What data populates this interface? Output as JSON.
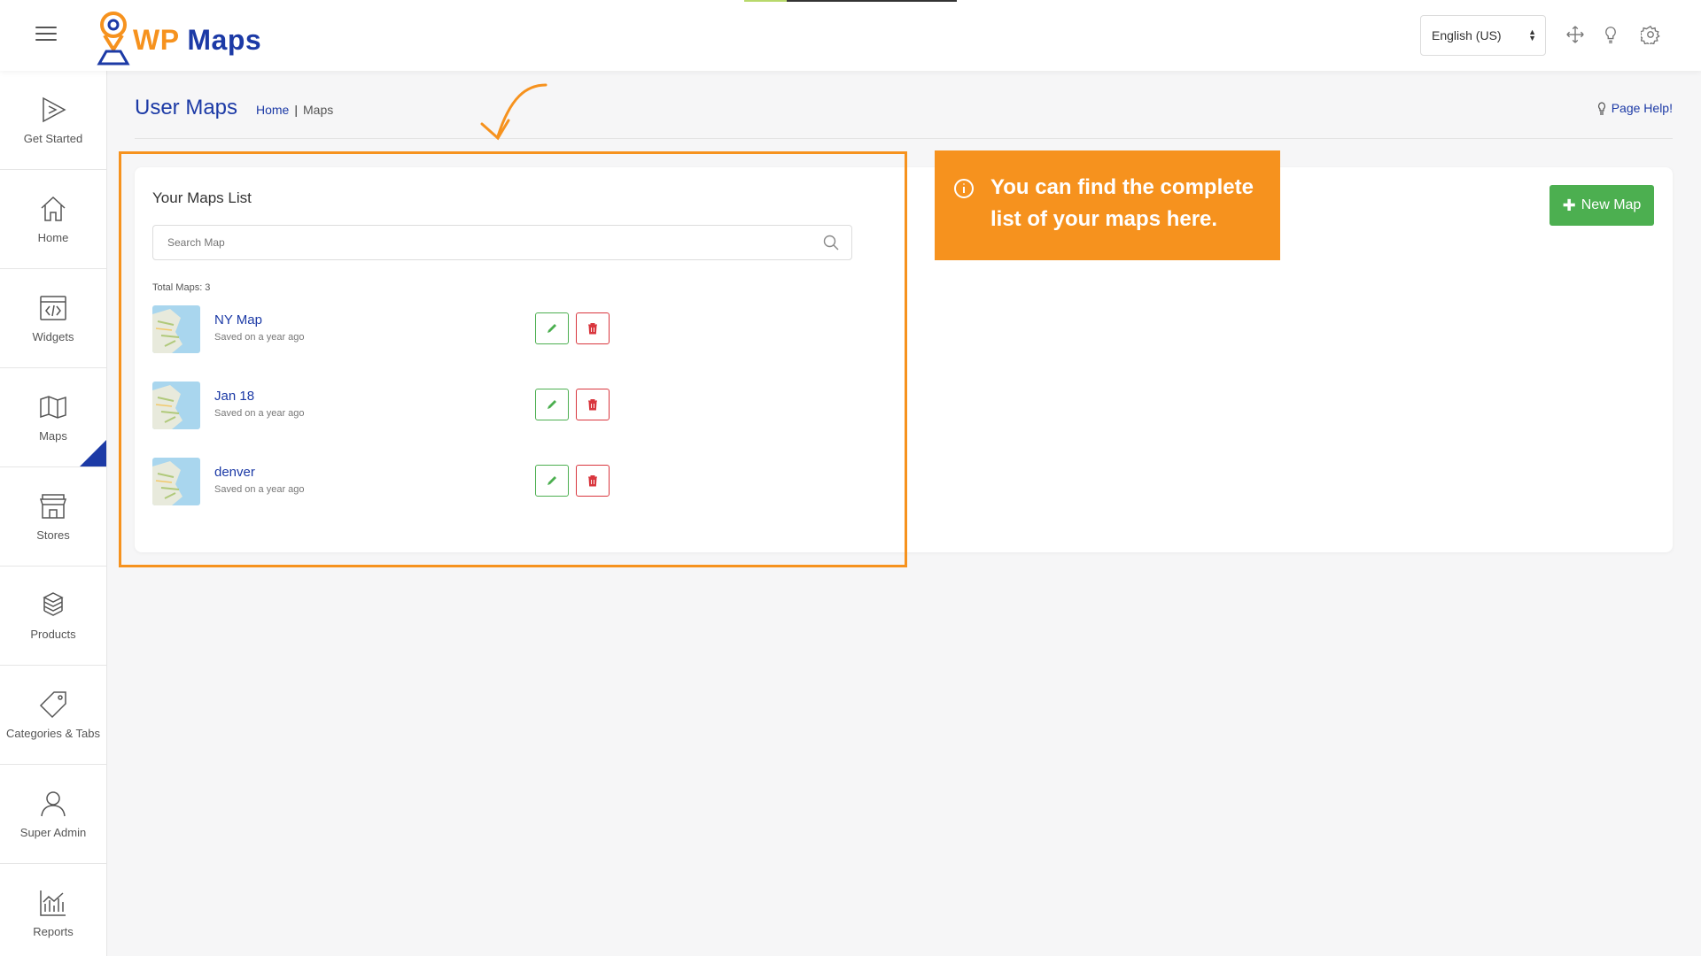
{
  "app": {
    "logo_prefix": "WP",
    "logo_suffix": " Maps",
    "language": "English (US)"
  },
  "sidebar": {
    "items": [
      {
        "label": "Get Started",
        "icon": "play-icon"
      },
      {
        "label": "Home",
        "icon": "home-icon"
      },
      {
        "label": "Widgets",
        "icon": "code-icon"
      },
      {
        "label": "Maps",
        "icon": "map-icon",
        "active": true
      },
      {
        "label": "Stores",
        "icon": "store-icon"
      },
      {
        "label": "Products",
        "icon": "boxes-icon"
      },
      {
        "label": "Categories & Tabs",
        "icon": "tag-icon"
      },
      {
        "label": "Super Admin",
        "icon": "user-icon"
      },
      {
        "label": "Reports",
        "icon": "chart-icon"
      }
    ]
  },
  "header": {
    "title": "User Maps",
    "breadcrumb": {
      "home": "Home",
      "separator": "|",
      "current": "Maps"
    },
    "page_help": "Page Help!"
  },
  "card": {
    "title": "Your Maps List",
    "search_placeholder": "Search Map",
    "total_label": "Total Maps: 3",
    "new_map_label": "New Map",
    "maps": [
      {
        "name": "NY Map",
        "saved": "Saved on a year ago"
      },
      {
        "name": "Jan 18",
        "saved": "Saved on a year ago"
      },
      {
        "name": "denver",
        "saved": "Saved on a year ago"
      }
    ]
  },
  "tutorial": {
    "tip_text": "You can find the complete list of your maps here."
  },
  "colors": {
    "brand_blue": "#1c3aa6",
    "brand_orange": "#f6921e",
    "success": "#4caf50",
    "danger": "#d9363e"
  }
}
